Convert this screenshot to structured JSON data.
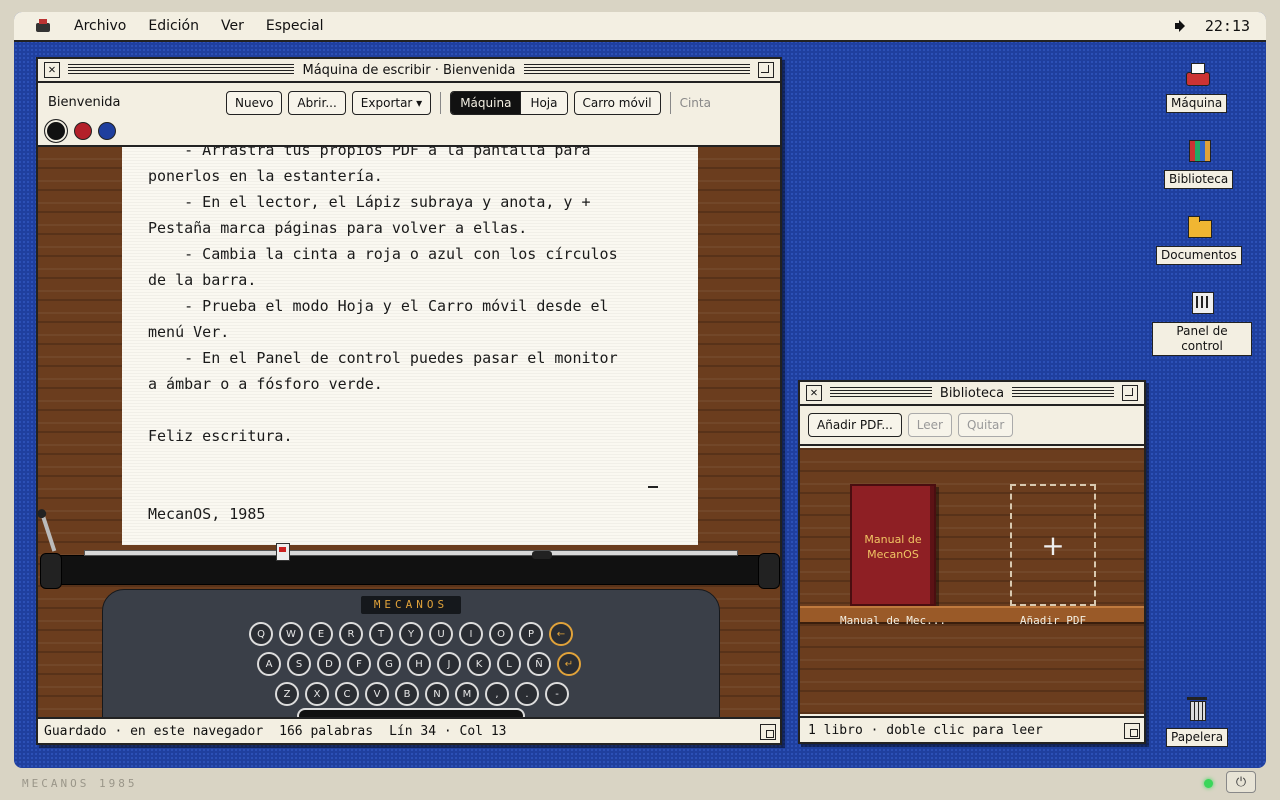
{
  "menubar": {
    "logo_icon": "typewriter-icon",
    "items": [
      "Archivo",
      "Edición",
      "Ver",
      "Especial"
    ],
    "clock": "22:13",
    "volume_icon": "speaker-icon"
  },
  "typewriter_window": {
    "title": "Máquina de escribir · Bienvenida",
    "doc_name": "Bienvenida",
    "buttons": {
      "new": "Nuevo",
      "open": "Abrir...",
      "export": "Exportar ▾",
      "mode_machine": "Máquina",
      "mode_sheet": "Hoja",
      "carriage": "Carro móvil",
      "ribbon_label": "Cinta"
    },
    "ribbon_colors": [
      "#111111",
      "#b3202a",
      "#1f3f9e"
    ],
    "selected_ribbon": "#111111",
    "lines": [
      "    - Arrastra tus propios PDF a la pantalla para",
      "ponerlos en la estantería.",
      "    - En el lector, el Lápiz subraya y anota, y +",
      "Pestaña marca páginas para volver a ellas.",
      "    - Cambia la cinta a roja o azul con los círculos",
      "de la barra.",
      "    - Prueba el modo Hoja y el Carro móvil desde el",
      "menú Ver.",
      "    - En el Panel de control puedes pasar el monitor",
      "a ámbar o a fósforo verde.",
      "",
      "Feliz escritura.",
      "",
      "",
      "MecanOS, 1985"
    ],
    "machine_brand": "MECANOS",
    "keys_row1": [
      "Q",
      "W",
      "E",
      "R",
      "T",
      "Y",
      "U",
      "I",
      "O",
      "P",
      "←"
    ],
    "keys_row2": [
      "A",
      "S",
      "D",
      "F",
      "G",
      "H",
      "J",
      "K",
      "L",
      "Ñ",
      "↵"
    ],
    "keys_row3": [
      "Z",
      "X",
      "C",
      "V",
      "B",
      "N",
      "M",
      ",",
      ".",
      "-"
    ],
    "status": {
      "saved": "Guardado · en este navegador",
      "words": "166 palabras",
      "position": "Lín 34 · Col 13"
    }
  },
  "library_window": {
    "title": "Biblioteca",
    "buttons": {
      "add": "Añadir PDF...",
      "read": "Leer",
      "remove": "Quitar"
    },
    "book": {
      "cover_line1": "Manual de",
      "cover_line2": "MecanOS",
      "label": "Manual de Mec..."
    },
    "add_slot": {
      "symbol": "+",
      "label": "Añadir PDF"
    },
    "status": "1 libro · doble clic para leer"
  },
  "desktop_icons": [
    {
      "label": "Máquina",
      "icon": "typewriter-icon"
    },
    {
      "label": "Biblioteca",
      "icon": "books-icon"
    },
    {
      "label": "Documentos",
      "icon": "folder-icon"
    },
    {
      "label": "Panel de control",
      "icon": "control-panel-icon"
    },
    {
      "label": "Papelera",
      "icon": "trash-icon"
    }
  ],
  "footer": {
    "brand": "MECANOS 1985",
    "power_symbol": "⏻"
  }
}
